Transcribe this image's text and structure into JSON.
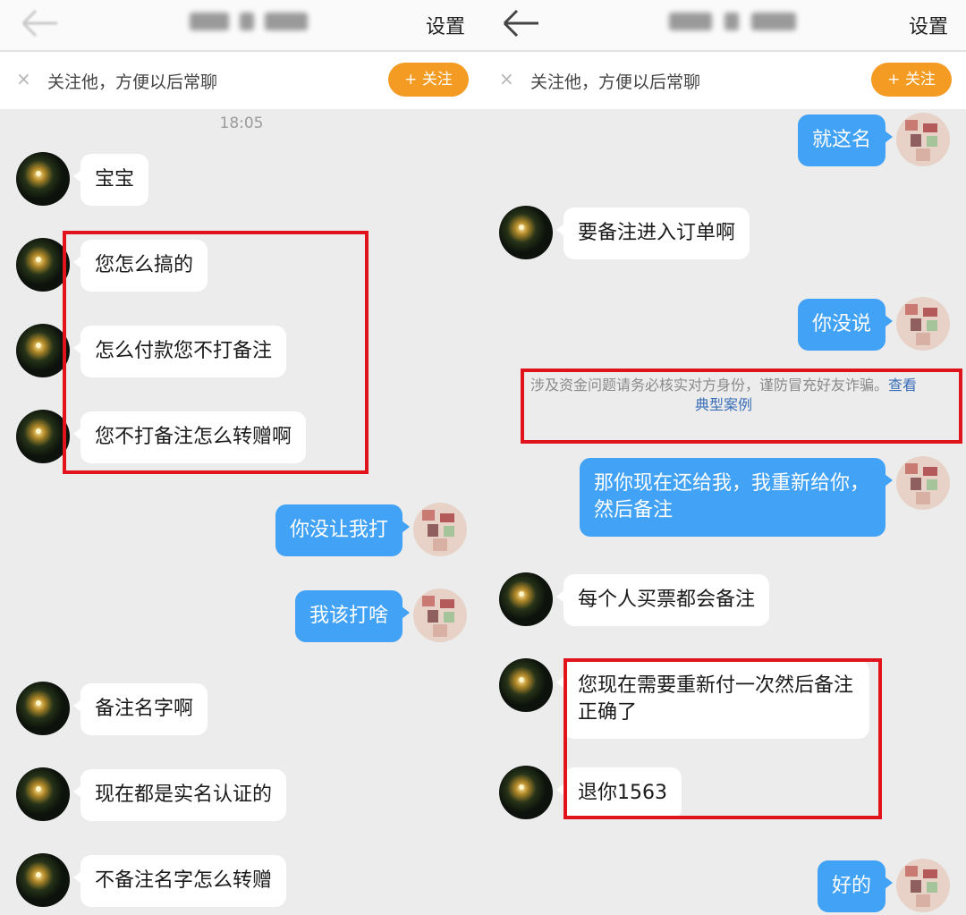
{
  "header": {
    "settings_label": "设置"
  },
  "follow_bar": {
    "close_icon": "×",
    "text": "关注他，方便以后常聊",
    "button_label": "+ 关注"
  },
  "left_chat": {
    "timestamp": "18:05",
    "messages": [
      {
        "from": "them",
        "text": "宝宝"
      },
      {
        "from": "them",
        "text": "您怎么搞的"
      },
      {
        "from": "them",
        "text": "怎么付款您不打备注"
      },
      {
        "from": "them",
        "text": "您不打备注怎么转赠啊"
      },
      {
        "from": "me",
        "text": "你没让我打"
      },
      {
        "from": "me",
        "text": "我该打啥"
      },
      {
        "from": "them",
        "text": "备注名字啊"
      },
      {
        "from": "them",
        "text": "现在都是实名认证的"
      },
      {
        "from": "them",
        "text": "不备注名字怎么转赠"
      }
    ]
  },
  "right_chat": {
    "messages": [
      {
        "from": "me",
        "text": "就这名"
      },
      {
        "from": "them",
        "text": "要备注进入订单啊"
      },
      {
        "from": "me",
        "text": "你没说"
      },
      {
        "from": "me",
        "text": "那你现在还给我，我重新给你，然后备注"
      },
      {
        "from": "them",
        "text": "每个人买票都会备注"
      },
      {
        "from": "them",
        "text": "您现在需要重新付一次然后备注正确了"
      },
      {
        "from": "them",
        "text": "退你1563"
      },
      {
        "from": "me",
        "text": "好的"
      }
    ],
    "notice": {
      "text": "涉及资金问题请务必核实对方身份，谨防冒充好友诈骗。",
      "link": "查看典型案例"
    }
  },
  "colors": {
    "outgoing_bubble": "#42a2f5",
    "incoming_bubble": "#ffffff",
    "follow_button": "#f39b22",
    "highlight_box": "#e1141e"
  },
  "icons": {
    "back": "back-arrow-icon",
    "close": "close-icon",
    "contact_avatar": "dark-night-avatar",
    "self_avatar": "pixelated-avatar"
  }
}
